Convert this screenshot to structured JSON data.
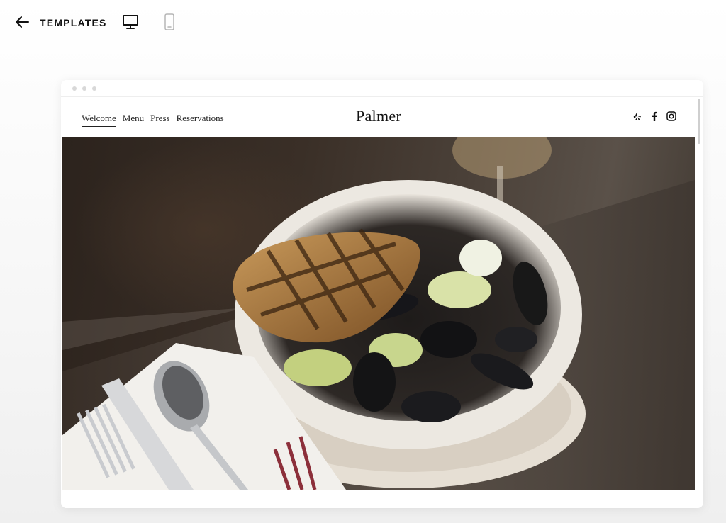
{
  "topbar": {
    "back_icon": "arrow-left-icon",
    "title": "TEMPLATES",
    "devices": [
      {
        "name": "desktop",
        "icon": "monitor-icon",
        "active": true
      },
      {
        "name": "mobile",
        "icon": "phone-icon",
        "active": false
      }
    ]
  },
  "preview": {
    "nav": {
      "links": [
        {
          "label": "Welcome",
          "active": true
        },
        {
          "label": "Menu",
          "active": false
        },
        {
          "label": "Press",
          "active": false
        },
        {
          "label": "Reservations",
          "active": false
        }
      ]
    },
    "site_title": "Palmer",
    "social_icons": [
      "yelp-icon",
      "facebook-icon",
      "instagram-icon"
    ]
  },
  "colors": {
    "text": "#111111",
    "frame_bg": "#ffffff",
    "page_bg": "#f4f4f4"
  }
}
